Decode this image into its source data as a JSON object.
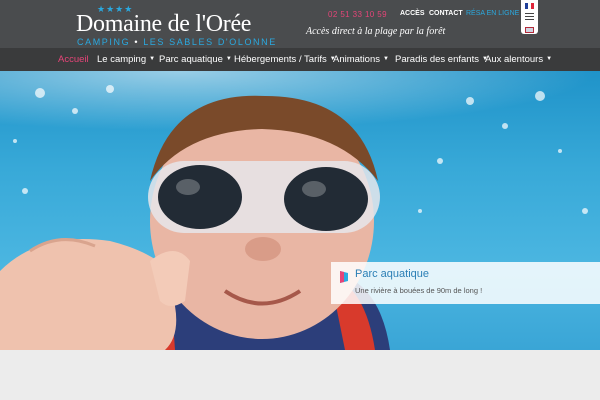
{
  "header": {
    "stars": "★★★★",
    "site_name": "Domaine de l'Orée",
    "subtitle_left": "CAMPING",
    "subtitle_sep": "•",
    "subtitle_right": "LES SABLES D'OLONNE",
    "phone": "02 51 33 10 59",
    "links": {
      "acces": "ACCÈS",
      "contact": "CONTACT",
      "resa": "RÉSA EN LIGNE"
    },
    "tagline": "Accès direct à la plage par la forêt"
  },
  "nav": {
    "items": [
      {
        "label": "Accueil",
        "active": true,
        "dropdown": false
      },
      {
        "label": "Le camping",
        "active": false,
        "dropdown": true
      },
      {
        "label": "Parc aquatique",
        "active": false,
        "dropdown": true
      },
      {
        "label": "Hébergements / Tarifs",
        "active": false,
        "dropdown": true
      },
      {
        "label": "Animations",
        "active": false,
        "dropdown": true
      },
      {
        "label": "Paradis des enfants",
        "active": false,
        "dropdown": true
      },
      {
        "label": "Aux alentours",
        "active": false,
        "dropdown": true
      }
    ],
    "caret": "▼"
  },
  "slide": {
    "title": "Parc aquatique",
    "text": "Une rivière à bouées de 90m de long !",
    "icon": "flag-icon"
  },
  "colors": {
    "header_bg": "#4a4c4e",
    "nav_bg": "#3a3b3c",
    "accent_blue": "#2aa9e0",
    "accent_pink": "#e54578"
  }
}
